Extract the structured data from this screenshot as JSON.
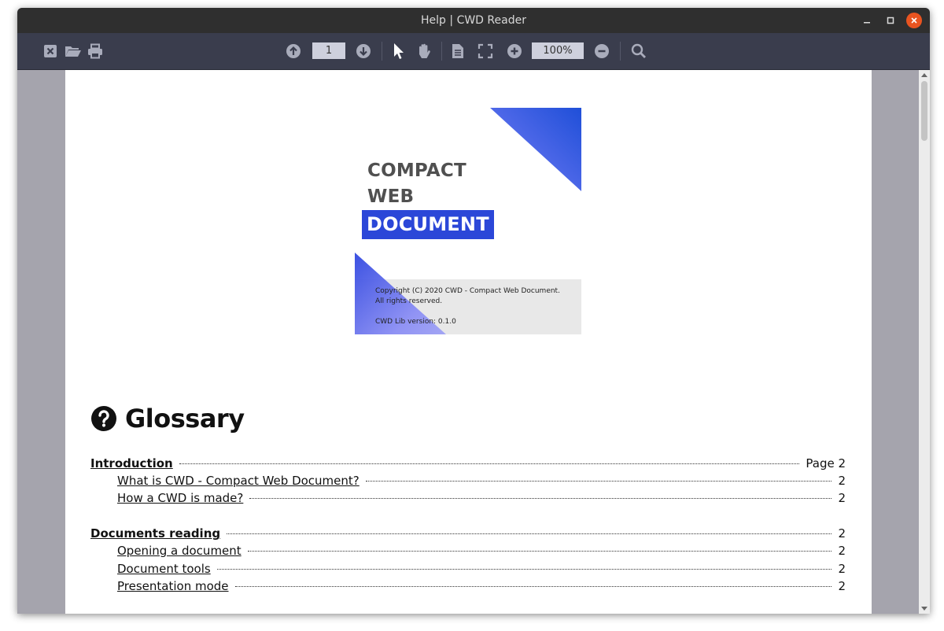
{
  "window": {
    "title": "Help | CWD Reader"
  },
  "toolbar": {
    "page_number": "1",
    "zoom": "100%"
  },
  "cover": {
    "line1": "COMPACT",
    "line2": "WEB",
    "line3": "DOCUMENT",
    "copyright": "Copyright (C) 2020 CWD - Compact Web Document.",
    "rights": "All rights reserved.",
    "version": "CWD Lib version: 0.1.0"
  },
  "glossary": {
    "title": "Glossary",
    "entries": [
      {
        "label": "Introduction",
        "page": "Page 2",
        "level": 1
      },
      {
        "label": "What is CWD - Compact Web Document?",
        "page": "2",
        "level": 2
      },
      {
        "label": "How a CWD is made?",
        "page": "2",
        "level": 2
      },
      {
        "label": "Documents reading",
        "page": "2",
        "level": 1
      },
      {
        "label": "Opening a document",
        "page": "2",
        "level": 2
      },
      {
        "label": "Document tools",
        "page": "2",
        "level": 2
      },
      {
        "label": "Presentation mode",
        "page": "2",
        "level": 2
      }
    ]
  },
  "colors": {
    "titlebar": "#2f2f2f",
    "toolbar": "#3a3d4d",
    "close_button": "#e95420",
    "cover_accent": "#2b47d8"
  }
}
